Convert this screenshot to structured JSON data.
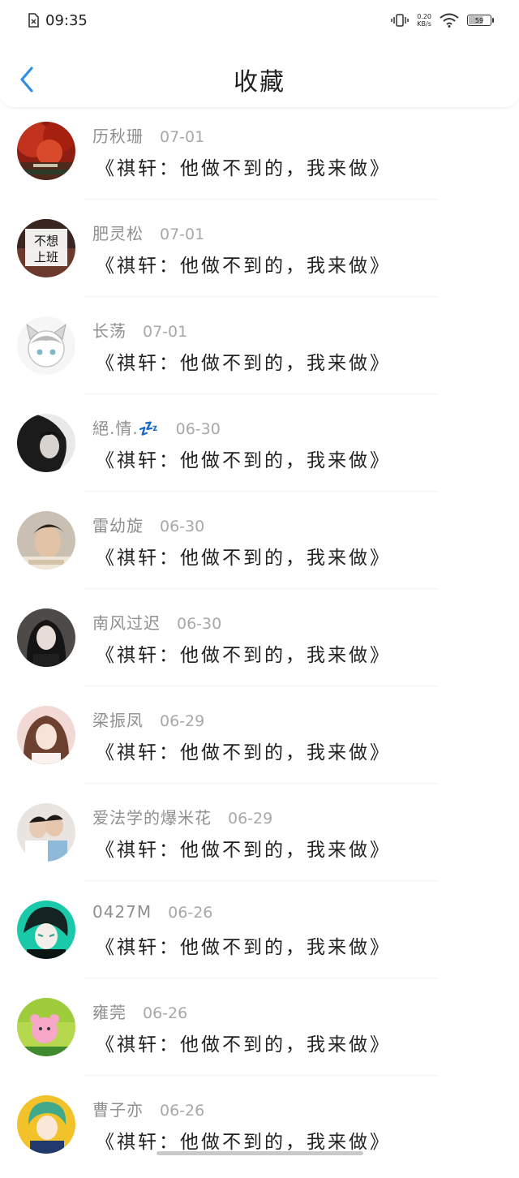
{
  "status_bar": {
    "time": "09:35",
    "net_speed_value": "0.20",
    "net_speed_unit": "KB/s",
    "battery_level": "59"
  },
  "header": {
    "title": "收藏"
  },
  "colors": {
    "accent": "#2f8fe6"
  },
  "items": [
    {
      "name": "历秋珊",
      "date": "07-01",
      "content": "《祺轩：他做不到的，我来做》"
    },
    {
      "name": "肥灵松",
      "date": "07-01",
      "content": "《祺轩：他做不到的，我来做》",
      "avatar_text_1": "不想",
      "avatar_text_2": "上班"
    },
    {
      "name": "长荡",
      "date": "07-01",
      "content": "《祺轩：他做不到的，我来做》"
    },
    {
      "name": "絕.情.💤",
      "date": "06-30",
      "content": "《祺轩：他做不到的，我来做》"
    },
    {
      "name": "雷幼旋",
      "date": "06-30",
      "content": "《祺轩：他做不到的，我来做》"
    },
    {
      "name": "南风过迟",
      "date": "06-30",
      "content": "《祺轩：他做不到的，我来做》"
    },
    {
      "name": "梁振凤",
      "date": "06-29",
      "content": "《祺轩：他做不到的，我来做》"
    },
    {
      "name": "爱法学的爆米花",
      "date": "06-29",
      "content": "《祺轩：他做不到的，我来做》"
    },
    {
      "name": "0427M",
      "date": "06-26",
      "content": "《祺轩：他做不到的，我来做》"
    },
    {
      "name": "雍莞",
      "date": "06-26",
      "content": "《祺轩：他做不到的，我来做》"
    },
    {
      "name": "曹子亦",
      "date": "06-26",
      "content": "《祺轩：他做不到的，我来做》"
    }
  ]
}
